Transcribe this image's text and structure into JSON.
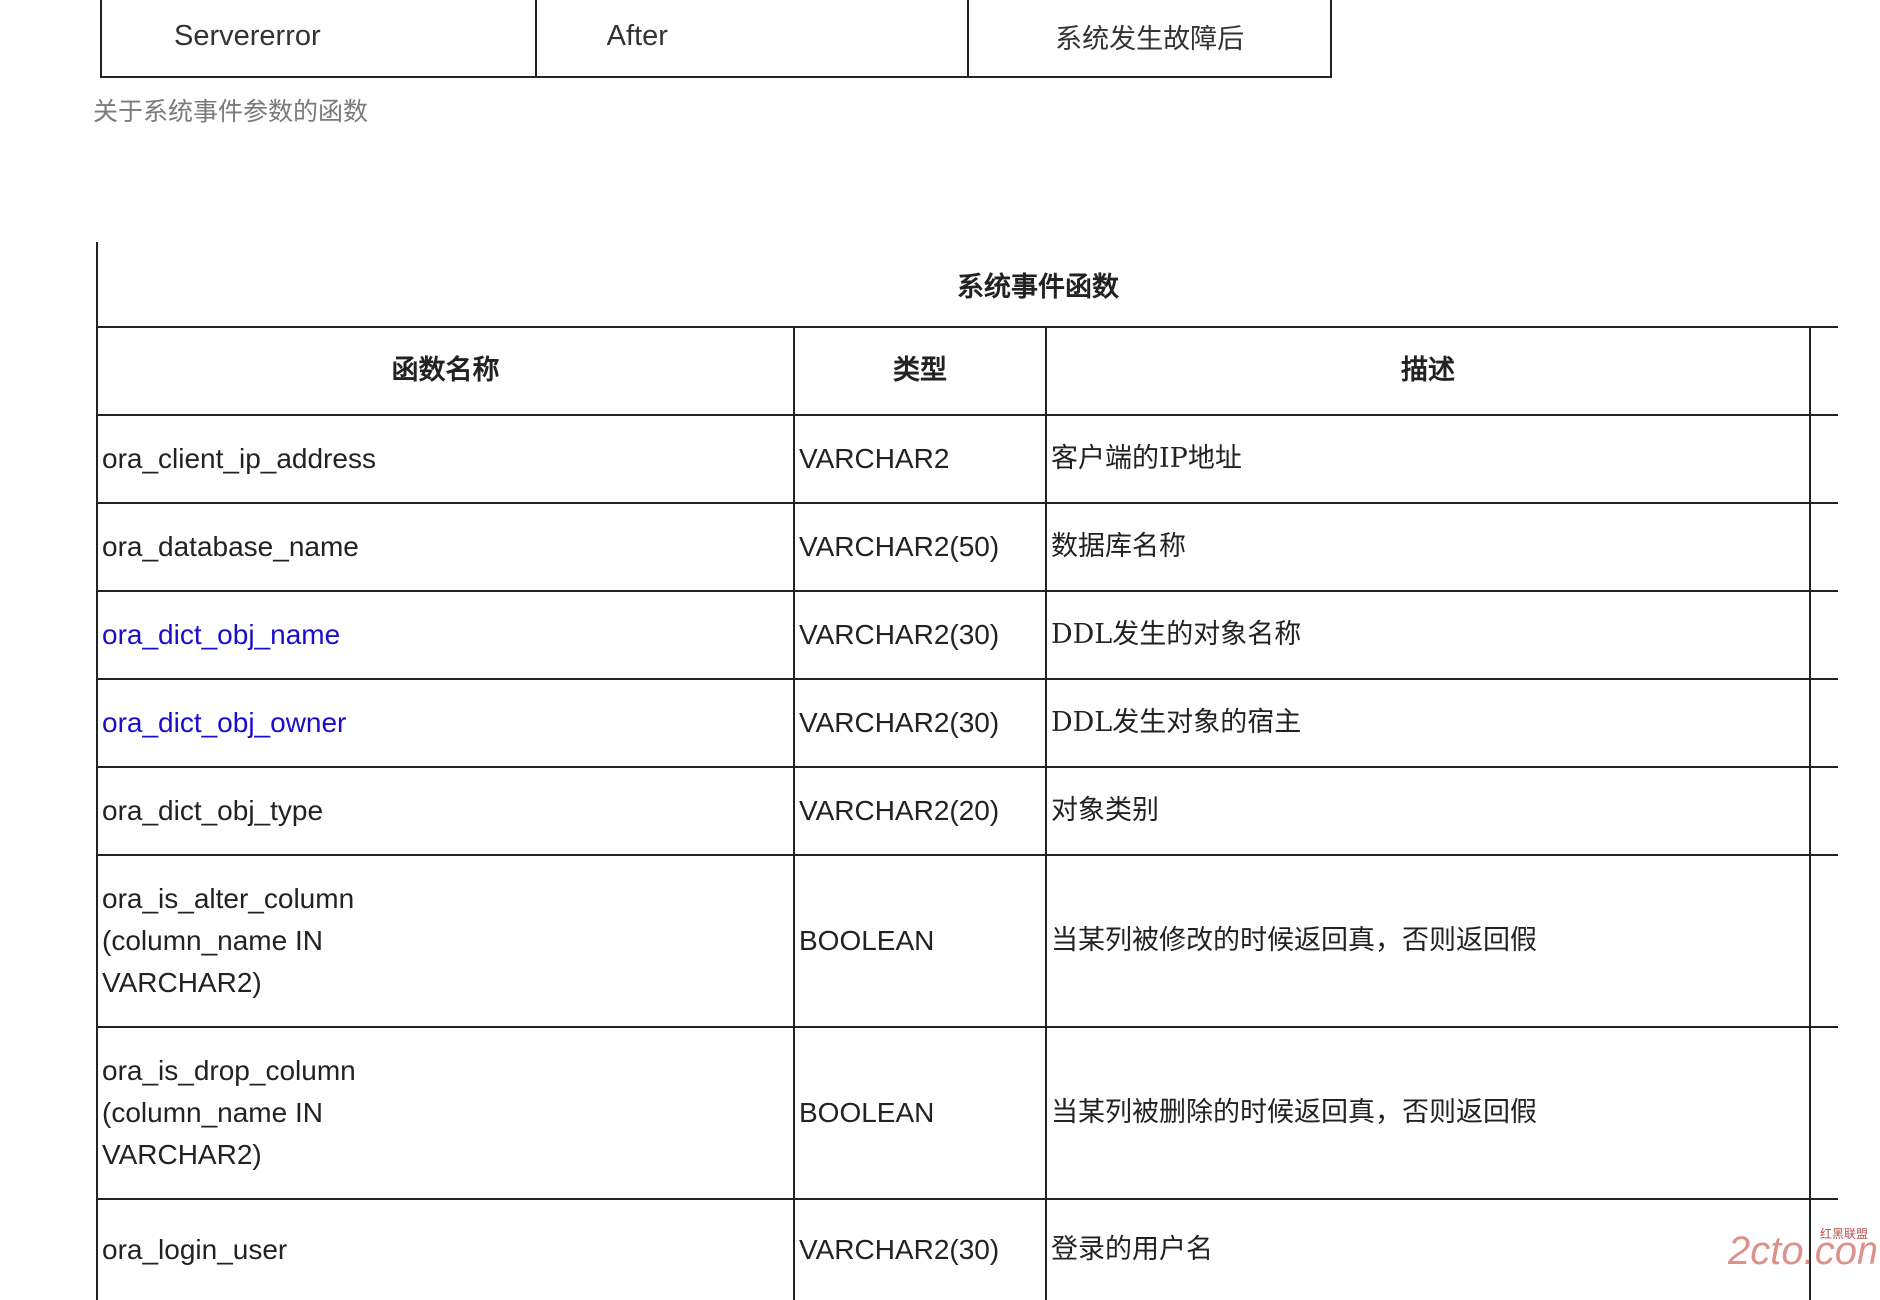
{
  "top_table": {
    "cells": [
      "Servererror",
      "After",
      "系统发生故障后"
    ]
  },
  "caption": "关于系统事件参数的函数",
  "main_table": {
    "title": "系统事件函数",
    "headers": [
      "函数名称",
      "类型",
      "描述"
    ],
    "rows": [
      {
        "name": "ora_client_ip_address",
        "type": "VARCHAR2",
        "desc": "客户端的IP地址",
        "link": false
      },
      {
        "name": "ora_database_name",
        "type": "VARCHAR2(50)",
        "desc": "数据库名称",
        "link": false
      },
      {
        "name": "ora_dict_obj_name",
        "type": "VARCHAR2(30)",
        "desc": "DDL发生的对象名称",
        "link": true
      },
      {
        "name": "ora_dict_obj_owner",
        "type": "VARCHAR2(30)",
        "desc": "DDL发生对象的宿主",
        "link": true
      },
      {
        "name": "ora_dict_obj_type",
        "type": "VARCHAR2(20)",
        "desc": "对象类别",
        "link": false
      },
      {
        "name": "ora_is_alter_column\n(column_name IN\nVARCHAR2)",
        "type": "BOOLEAN",
        "desc": "当某列被修改的时候返回真，否则返回假",
        "link": false
      },
      {
        "name": "ora_is_drop_column\n(column_name IN\nVARCHAR2)",
        "type": "BOOLEAN",
        "desc": "当某列被删除的时候返回真，否则返回假",
        "link": false
      },
      {
        "name": "ora_login_user",
        "type": "VARCHAR2(30)",
        "desc": "登录的用户名",
        "link": false
      }
    ]
  },
  "watermark": {
    "logo_text": "2cto.com",
    "sub_text": "红黑联盟",
    "color": "#c0392b"
  },
  "colors": {
    "link": "#1a0dcc",
    "border": "#222222",
    "caption": "#7a7a7a"
  }
}
